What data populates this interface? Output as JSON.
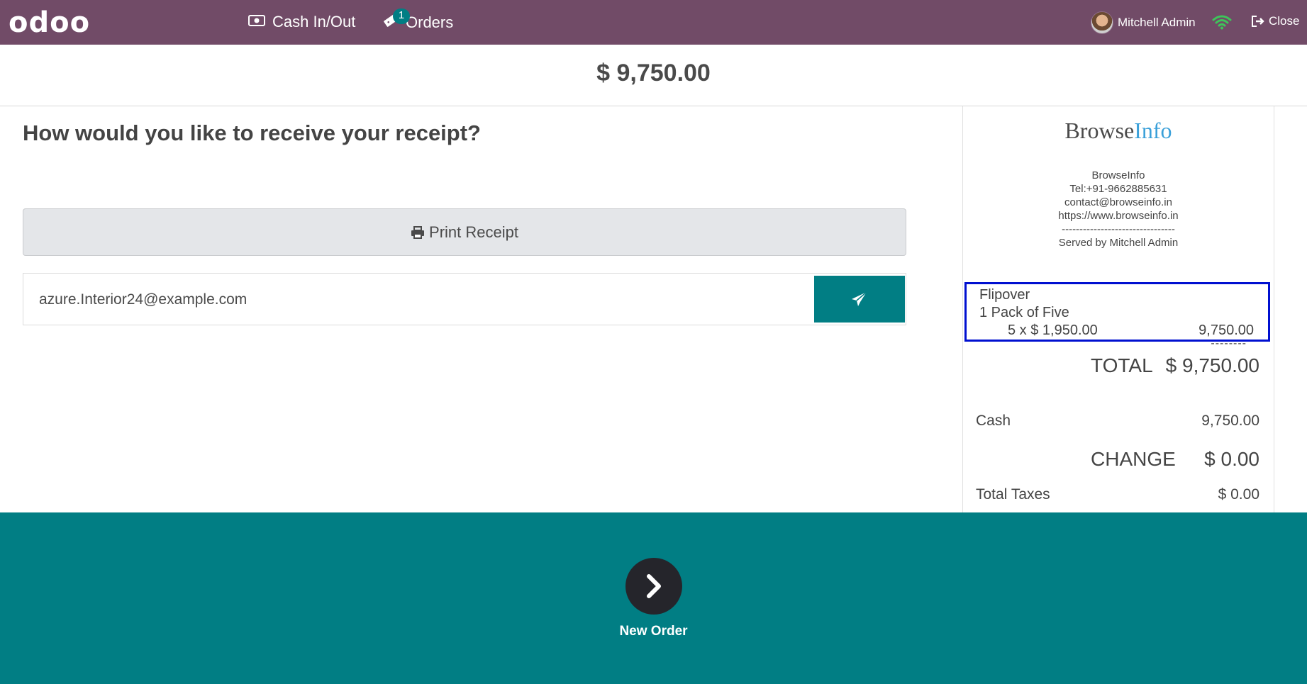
{
  "navbar": {
    "logo": "odoo",
    "cash_label": "Cash In/Out",
    "orders_label": "Orders",
    "orders_badge": "1",
    "user_name": "Mitchell Admin",
    "close_label": "Close"
  },
  "header": {
    "total": "$ 9,750.00"
  },
  "receipt_options": {
    "question": "How would you like to receive your receipt?",
    "print_label": "Print Receipt",
    "email_value": "azure.Interior24@example.com"
  },
  "receipt": {
    "brand_main": "Browse",
    "brand_accent": "Info",
    "company_lines": [
      "BrowseInfo",
      "Tel:+91-9662885631",
      "contact@browseinfo.in",
      "https://www.browseinfo.in",
      "--------------------------------",
      "Served by Mitchell Admin"
    ],
    "item": {
      "name": "Flipover",
      "pack": "1 Pack of Five",
      "qty_price": "5 x $ 1,950.00",
      "amount": "9,750.00"
    },
    "separator": "--------",
    "total_label": "TOTAL",
    "total_value": "$ 9,750.00",
    "cash_label": "Cash",
    "cash_value": "9,750.00",
    "change_label": "CHANGE",
    "change_value": "$ 0.00",
    "taxes_label": "Total Taxes",
    "taxes_value": "$ 0.00"
  },
  "footer": {
    "new_order_label": "New Order"
  },
  "colors": {
    "navbar": "#714B67",
    "teal": "#017E84",
    "highlight_box": "#0010d0",
    "brand_accent": "#3aa0d9"
  }
}
